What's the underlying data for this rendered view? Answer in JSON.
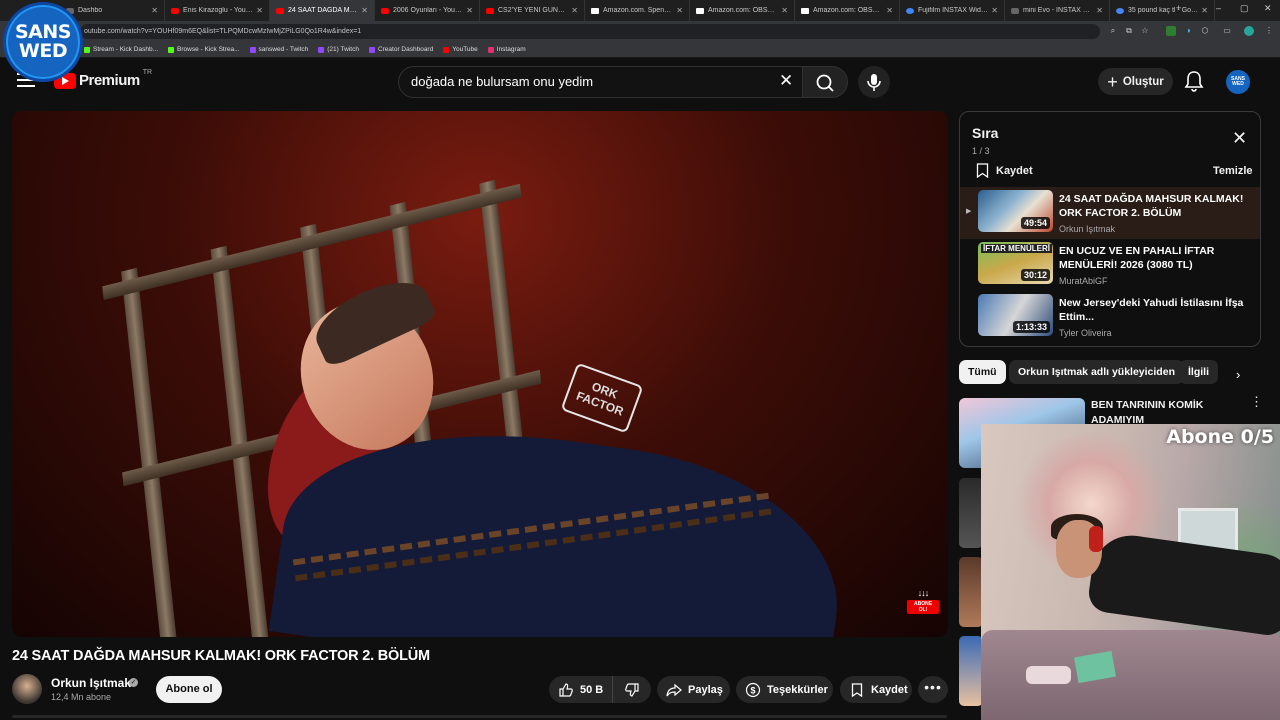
{
  "browser": {
    "tabs": [
      {
        "label": "Dashbo",
        "fav": "none",
        "active": false
      },
      {
        "label": "Enis Kirazoglu - YouTube",
        "fav": "yt",
        "active": false
      },
      {
        "label": "24 SAAT DAĞDA MAH",
        "fav": "yt",
        "active": true
      },
      {
        "label": "2006 Oyunları - YouTube",
        "fav": "yt",
        "active": false
      },
      {
        "label": "CS2'YE YENİ GÜNCELLEM",
        "fav": "yt",
        "active": false
      },
      {
        "label": "Amazon.com. Spend less.",
        "fav": "amz",
        "active": false
      },
      {
        "label": "Amazon.com: OBSBOT M",
        "fav": "amz",
        "active": false
      },
      {
        "label": "Amazon.com: OBSBOT Ti",
        "fav": "amz",
        "active": false
      },
      {
        "label": "Fujifilm INSTAX Wide Evo",
        "fav": "g",
        "active": false
      },
      {
        "label": "mini Evo - INSTAX by Fuji",
        "fav": "none",
        "active": false
      },
      {
        "label": "35 pound kaç tl - Google",
        "fav": "g",
        "active": false
      }
    ],
    "url": "outube.com/watch?v=YOUHf09m6EQ&list=TLPQMDcwMzIwMjZPiLG0Qo1R4w&index=1",
    "bookmarks": [
      "Stream - Kick Dashb...",
      "Browse - Kick Strea...",
      "sanswed - Twitch",
      "(21) Twitch",
      "Creator Dashboard",
      "YouTube",
      "Instagram"
    ]
  },
  "overlay_logo": {
    "line1": "SANS",
    "line2": "WED"
  },
  "header": {
    "logo_text": "Premium",
    "country_code": "TR",
    "search_value": "doğada ne bulursam onu yedim",
    "create_label": "Oluştur",
    "avatar_line1": "SANS",
    "avatar_line2": "WED"
  },
  "player": {
    "sweatshirt_logo": "ORK FACTOR",
    "abone_arrows": "↓↓↓",
    "abone_line1": "ABONE",
    "abone_line2": "OL!"
  },
  "video": {
    "title": "24 SAAT DAĞDA MAHSUR KALMAK! ORK FACTOR 2. BÖLÜM",
    "channel": "Orkun Işıtmak",
    "subscribers": "12,4 Mn abone",
    "subscribe_label": "Abone ol",
    "likes": "50 B",
    "share_label": "Paylaş",
    "thanks_label": "Teşekkürler",
    "save_label": "Kaydet"
  },
  "queue": {
    "title": "Sıra",
    "count": "1 / 3",
    "save_label": "Kaydet",
    "clear_label": "Temizle",
    "items": [
      {
        "title": "24 SAAT DAĞDA MAHSUR KALMAK! ORK FACTOR 2. BÖLÜM",
        "channel": "Orkun Işıtmak",
        "duration": "49:54"
      },
      {
        "title": "EN UCUZ VE EN PAHALI İFTAR MENÜLERİ! 2026 (3080 TL)",
        "channel": "MuratAbiGF",
        "duration": "30:12",
        "thumb_text": "İFTAR MENÜLERİ"
      },
      {
        "title": "New Jersey'deki Yahudi İstilasını İfşa Ettim...",
        "channel": "Tyler Oliveira",
        "duration": "1:13:33"
      }
    ]
  },
  "chips": [
    "Tümü",
    "Orkun Işıtmak adlı yükleyiciden",
    "İlgili"
  ],
  "suggestion": {
    "title": "BEN TANRININ KOMİK ADAMIYIM"
  },
  "webcam": {
    "abone_counter": "Abone 0/5"
  },
  "colors": {
    "brand_red": "#ff0000",
    "background": "#0f0f0f",
    "pill": "#272727",
    "logo_blue": "#1565c0"
  }
}
